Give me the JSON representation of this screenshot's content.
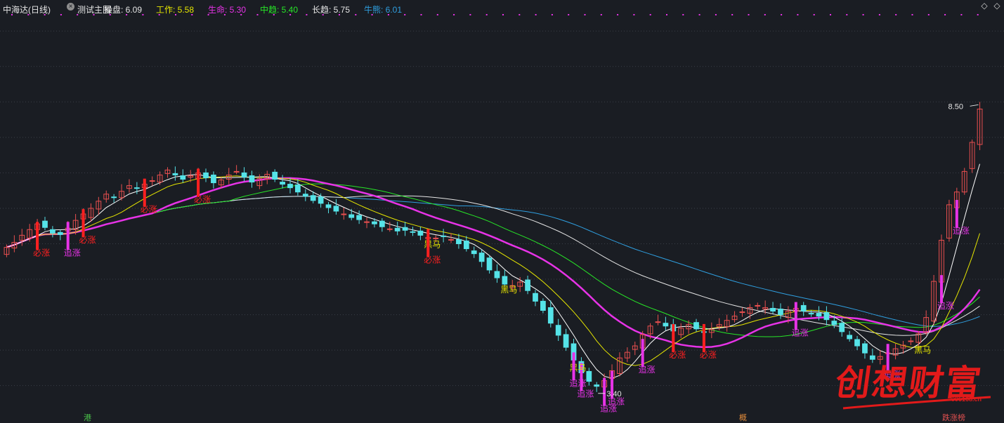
{
  "header": {
    "stock_name": "中海达(日线)",
    "indicator_name": "测试主图",
    "items": [
      {
        "label": "操盘:",
        "value": "6.09",
        "color": "#e6e6e6"
      },
      {
        "label": "工作:",
        "value": "5.58",
        "color": "#e6e600"
      },
      {
        "label": "生命:",
        "value": "5.30",
        "color": "#e733e7"
      },
      {
        "label": "中趋:",
        "value": "5.40",
        "color": "#27e627"
      },
      {
        "label": "长趋:",
        "value": "5.75",
        "color": "#e6e6e6"
      },
      {
        "label": "牛熊:",
        "value": "6.01",
        "color": "#2f9fe0"
      }
    ]
  },
  "watermark": {
    "text": "创想财富",
    "url": "995168.cn"
  },
  "footer_tags": [
    {
      "text": "港",
      "color": "#49c449"
    },
    {
      "text": "概",
      "color": "#e08a3a"
    },
    {
      "text": "跌涨榜",
      "color": "#e05050"
    }
  ],
  "colors": {
    "background": "#1a1d23",
    "up": "#e94f4f",
    "down": "#55e3e8",
    "ma_work": "#e6e600",
    "ma_life": "#e733e7",
    "ma_mid": "#27e627",
    "ma_long": "#e6e6e6",
    "ma_bull": "#2f9fe0",
    "ma_operate": "#ffffff",
    "signal_bizhang": "#ff2020",
    "signal_zhuizhang": "#e733e7",
    "signal_heima": "#e6e600"
  },
  "chart_data": {
    "type": "candlestick",
    "x": [
      0,
      1,
      2,
      3,
      4,
      5,
      6,
      7,
      8,
      9,
      10,
      11,
      12,
      13,
      14,
      15,
      16,
      17,
      18,
      19,
      20,
      21,
      22,
      23,
      24,
      25,
      26,
      27,
      28,
      29,
      30,
      31,
      32,
      33,
      34,
      35,
      36,
      37,
      38,
      39,
      40,
      41,
      42,
      43,
      44,
      45,
      46,
      47,
      48,
      49,
      50,
      51,
      52,
      53,
      54,
      55,
      56,
      57,
      58,
      59,
      60,
      61,
      62,
      63,
      64,
      65,
      66,
      67,
      68,
      69,
      70,
      71,
      72,
      73,
      74,
      75,
      76,
      77,
      78,
      79,
      80,
      81,
      82,
      83,
      84,
      85,
      86,
      87,
      88,
      89,
      90,
      91,
      92,
      93,
      94,
      95,
      96,
      97,
      98,
      99,
      100,
      101,
      102,
      103,
      104,
      105,
      106,
      107,
      108,
      109,
      110,
      111,
      112,
      113,
      114,
      115,
      116,
      117,
      118,
      119,
      120,
      121,
      122,
      123,
      124,
      125,
      126,
      127,
      128,
      129,
      130,
      131,
      132,
      133,
      134,
      135,
      136,
      137,
      138,
      139,
      140,
      141,
      142,
      143,
      144,
      145,
      146,
      147,
      148,
      149,
      150,
      151,
      152,
      153,
      154,
      155,
      156,
      157,
      158,
      159,
      160,
      161,
      162,
      163,
      164,
      165,
      166,
      167,
      168,
      169,
      170,
      171,
      172,
      173,
      174,
      175,
      176,
      177,
      178,
      179,
      180,
      181,
      182,
      183,
      184,
      185,
      186,
      187,
      188,
      189,
      190
    ],
    "series": [
      {
        "name": "K线",
        "close": [
          5.45,
          5.52,
          5.62,
          5.7,
          5.78,
          5.73,
          5.65,
          5.63,
          5.72,
          5.83,
          5.92,
          6.0,
          6.1,
          6.2,
          6.15,
          6.24,
          6.32,
          6.28,
          6.34,
          6.39,
          6.47,
          6.54,
          6.47,
          6.41,
          6.46,
          6.5,
          6.43,
          6.36,
          6.4,
          6.47,
          6.52,
          6.44,
          6.37,
          6.42,
          6.48,
          6.41,
          6.34,
          6.29,
          6.23,
          6.17,
          6.11,
          6.07,
          6.01,
          5.96,
          5.92,
          5.87,
          5.84,
          5.81,
          5.78,
          5.74,
          5.71,
          5.68,
          5.69,
          5.66,
          5.62,
          5.59,
          5.58,
          5.6,
          5.56,
          5.5,
          5.43,
          5.36,
          5.25,
          5.13,
          5.02,
          4.93,
          4.91,
          4.96,
          4.84,
          4.69,
          4.56,
          4.38,
          4.21,
          4.04,
          3.86,
          3.68,
          3.56,
          3.49,
          3.57,
          3.71,
          3.89,
          3.97,
          4.06,
          4.22,
          4.34,
          4.4,
          4.34,
          4.27,
          4.31,
          4.36,
          4.3,
          4.25,
          4.29,
          4.36,
          4.42,
          4.48,
          4.54,
          4.6,
          4.63,
          4.6,
          4.55,
          4.5,
          4.55,
          4.59,
          4.55,
          4.51,
          4.48,
          4.43,
          4.36,
          4.26,
          4.16,
          4.06,
          3.96,
          3.87,
          3.91,
          3.96,
          4.02,
          4.07,
          4.13,
          4.23,
          4.46,
          4.97,
          5.55,
          6.05,
          6.23,
          6.52,
          6.93,
          7.4,
          7.85,
          8.22,
          8.5,
          8.3,
          8.1,
          7.95,
          7.85,
          7.8,
          7.82,
          7.9,
          7.95,
          8.0,
          8.05,
          8.1,
          8.15,
          8.2,
          8.25,
          8.3,
          8.32,
          8.35,
          8.38,
          8.4,
          8.42,
          8.44,
          8.46,
          8.48,
          8.5,
          8.5,
          8.5,
          8.5,
          8.5,
          8.5,
          8.5,
          8.5,
          8.5,
          8.5,
          8.5,
          8.5,
          8.5,
          8.5,
          8.5,
          8.5,
          8.5,
          8.5,
          8.5,
          8.5,
          8.5,
          8.5,
          8.5,
          8.5,
          8.5,
          8.5,
          8.5,
          8.5,
          8.5,
          8.5,
          8.5,
          8.5,
          8.5
        ]
      },
      {
        "name": "工作",
        "values": [
          5.58
        ]
      },
      {
        "name": "生命",
        "values": [
          5.3
        ]
      },
      {
        "name": "中趋",
        "values": [
          5.4
        ]
      },
      {
        "name": "长趋",
        "values": [
          5.75
        ]
      },
      {
        "name": "牛熊",
        "values": [
          6.01
        ]
      }
    ],
    "bars_visible": 128,
    "ylim": [
      3.2,
      8.7
    ],
    "high_label": "8.50",
    "low_label": "3.40",
    "signals": [
      {
        "index": 4,
        "text": "必涨",
        "kind": "bizhang"
      },
      {
        "index": 8,
        "text": "追涨",
        "kind": "zhuizhang"
      },
      {
        "index": 10,
        "text": "必涨",
        "kind": "bizhang"
      },
      {
        "index": 18,
        "text": "必涨",
        "kind": "bizhang"
      },
      {
        "index": 25,
        "text": "必涨",
        "kind": "bizhang"
      },
      {
        "index": 55,
        "text": "黑马",
        "kind": "heima"
      },
      {
        "index": 55,
        "text": "必涨",
        "kind": "bizhang"
      },
      {
        "index": 65,
        "text": "黑马",
        "kind": "heima"
      },
      {
        "index": 75,
        "text": "追涨",
        "kind": "zhuizhang"
      },
      {
        "index": 74,
        "text": "黑马",
        "kind": "heima"
      },
      {
        "index": 74,
        "text": "追涨",
        "kind": "zhuizhang"
      },
      {
        "index": 78,
        "text": "追涨",
        "kind": "zhuizhang"
      },
      {
        "index": 79,
        "text": "追涨",
        "kind": "zhuizhang"
      },
      {
        "index": 83,
        "text": "追涨",
        "kind": "zhuizhang"
      },
      {
        "index": 87,
        "text": "必涨",
        "kind": "bizhang"
      },
      {
        "index": 91,
        "text": "必涨",
        "kind": "bizhang"
      },
      {
        "index": 103,
        "text": "追涨",
        "kind": "zhuizhang"
      },
      {
        "index": 115,
        "text": "追涨",
        "kind": "zhuizhang"
      },
      {
        "index": 119,
        "text": "黑马",
        "kind": "heima"
      },
      {
        "index": 122,
        "text": "追涨",
        "kind": "zhuizhang"
      },
      {
        "index": 124,
        "text": "追涨",
        "kind": "zhuizhang"
      }
    ],
    "grid": true
  }
}
